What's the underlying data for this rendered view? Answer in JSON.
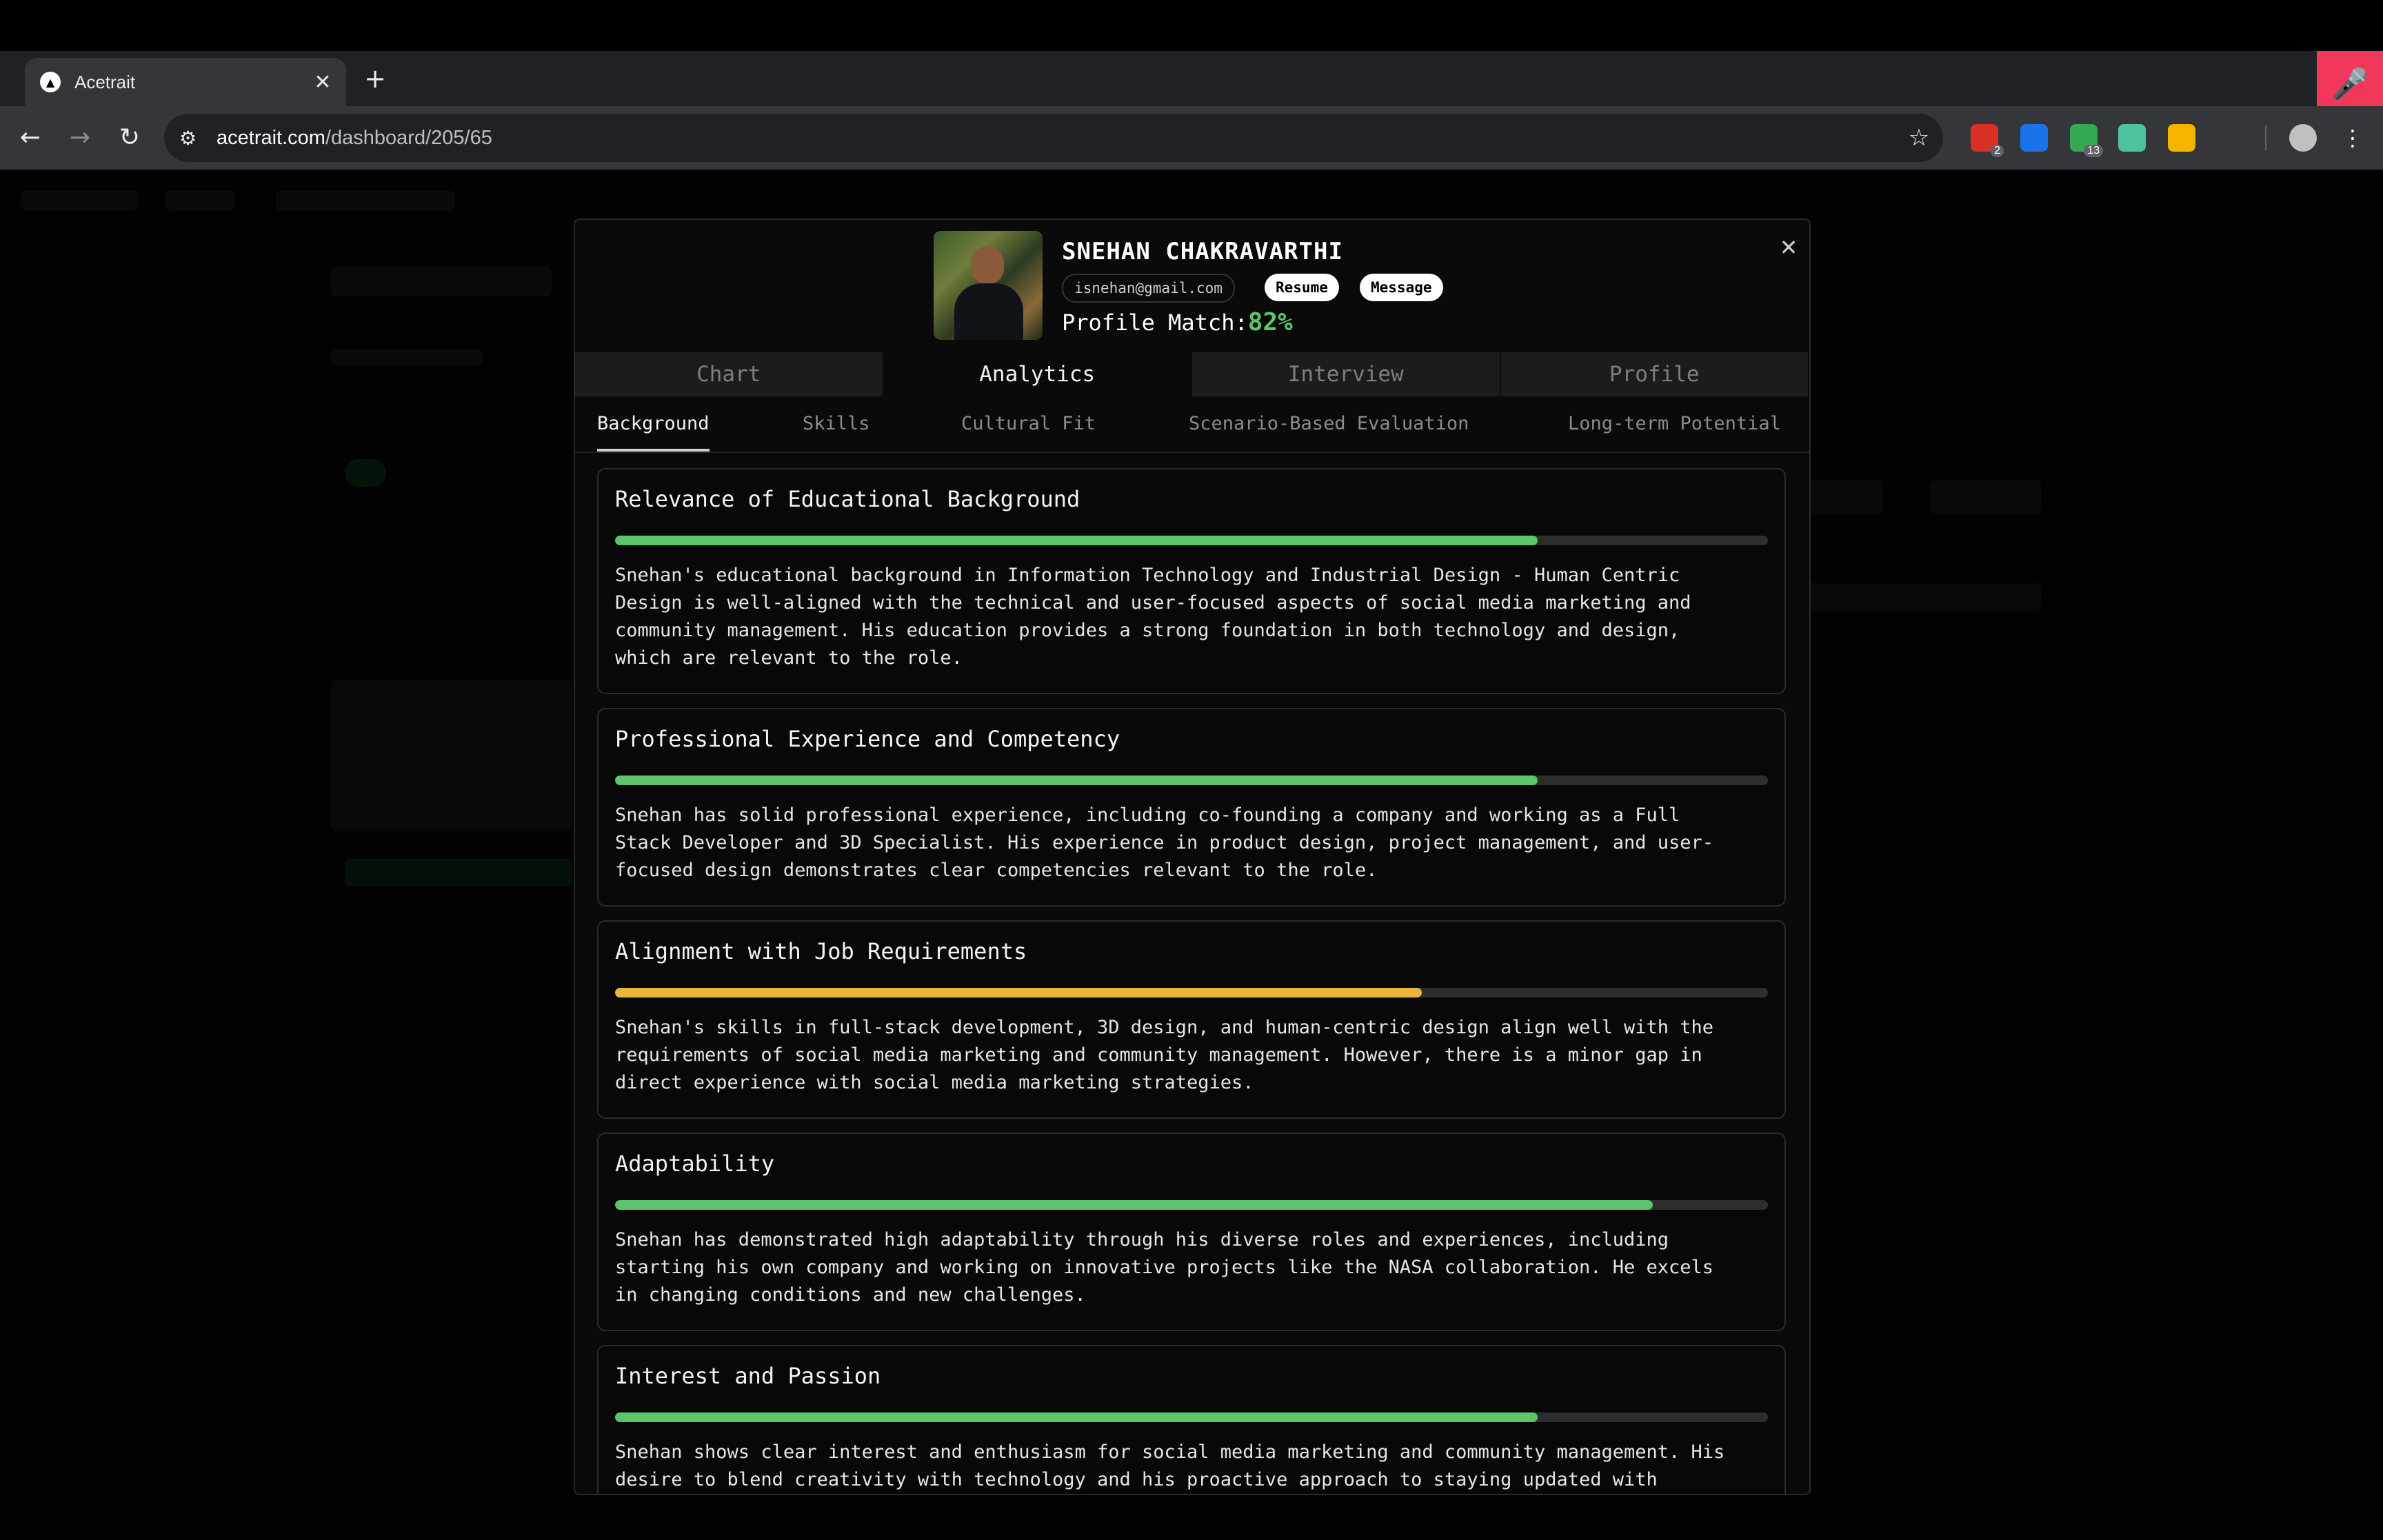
{
  "browser": {
    "tab_title": "Acetrait",
    "url_host": "acetrait.com",
    "url_path": "/dashboard/205/65",
    "extensions": [
      {
        "name": "ext-1",
        "badge": "2",
        "color": "#d93025"
      },
      {
        "name": "ext-2",
        "badge": "",
        "color": "#1a73e8"
      },
      {
        "name": "ext-3",
        "badge": "13",
        "color": "#34a853"
      },
      {
        "name": "ext-4",
        "badge": "",
        "color": "#4fc3a1"
      },
      {
        "name": "ext-5",
        "badge": "",
        "color": "#f5b400"
      }
    ]
  },
  "candidate": {
    "name": "SNEHAN CHAKRAVARTHI",
    "email": "isnehan@gmail.com",
    "resume_label": "Resume",
    "message_label": "Message",
    "match_label": "Profile Match:",
    "match_value": "82%"
  },
  "main_tabs": [
    "Chart",
    "Analytics",
    "Interview",
    "Profile"
  ],
  "active_main_tab": "Analytics",
  "sub_tabs": [
    "Background",
    "Skills",
    "Cultural Fit",
    "Scenario-Based Evaluation",
    "Long-term Potential"
  ],
  "active_sub_tab": "Background",
  "colors": {
    "green": "#5cc46a",
    "yellow": "#e8b83c",
    "track": "#2d2d2d"
  },
  "cards": [
    {
      "title": "Relevance of Educational Background",
      "score": 0.8,
      "color": "green",
      "text": "Snehan's educational background in Information Technology and Industrial Design - Human Centric\nDesign is well-aligned with the technical and user-focused aspects of social media marketing and\ncommunity management. His education provides a strong foundation in both technology and design,\nwhich are relevant to the role."
    },
    {
      "title": "Professional Experience and Competency",
      "score": 0.8,
      "color": "green",
      "text": "Snehan has solid professional experience, including co-founding a company and working as a Full\nStack Developer and 3D Specialist. His experience in product design, project management, and user-\nfocused design demonstrates clear competencies relevant to the role."
    },
    {
      "title": "Alignment with Job Requirements",
      "score": 0.7,
      "color": "yellow",
      "text": "Snehan's skills in full-stack development, 3D design, and human-centric design align well with the\nrequirements of social media marketing and community management. However, there is a minor gap in\ndirect experience with social media marketing strategies."
    },
    {
      "title": "Adaptability",
      "score": 0.9,
      "color": "green",
      "text": "Snehan has demonstrated high adaptability through his diverse roles and experiences, including\nstarting his own company and working on innovative projects like the NASA collaboration. He excels\nin changing conditions and new challenges."
    },
    {
      "title": "Interest and Passion",
      "score": 0.8,
      "color": "green",
      "text": "Snehan shows clear interest and enthusiasm for social media marketing and community management. His\ndesire to blend creativity with technology and his proactive approach to staying updated with"
    }
  ]
}
